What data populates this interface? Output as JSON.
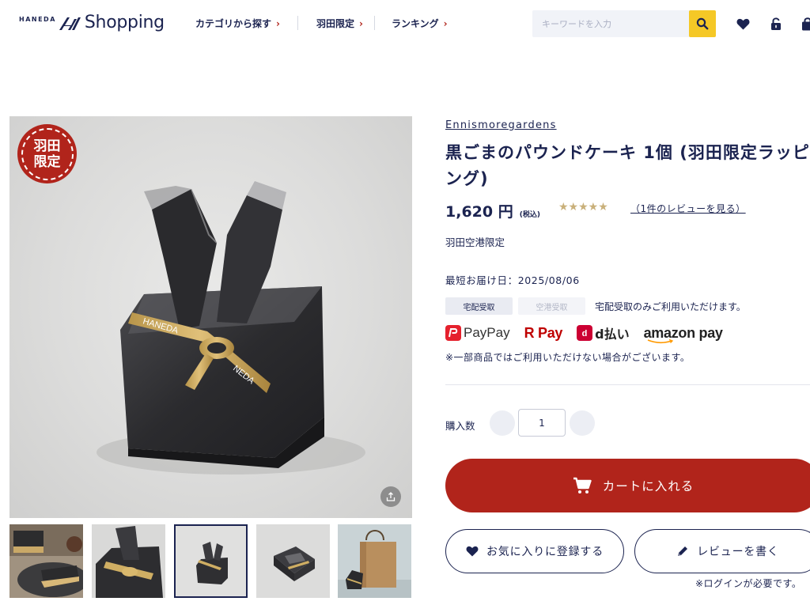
{
  "header": {
    "logo_small": "HANEDA",
    "logo_main": "Shopping",
    "nav": [
      {
        "label": "カテゴリから探す"
      },
      {
        "label": "羽田限定"
      },
      {
        "label": "ランキング"
      }
    ],
    "search_placeholder": "キーワードを入力"
  },
  "gallery": {
    "badge": "羽田限定",
    "thumbnails": [
      {
        "icon": "cake-slice-photo"
      },
      {
        "icon": "wrapped-package-photo"
      },
      {
        "icon": "wrapped-package-photo",
        "selected": true
      },
      {
        "icon": "open-package-photo"
      },
      {
        "icon": "shopping-bag-photo"
      }
    ]
  },
  "product": {
    "brand": "Ennismoregardens",
    "title": "黒ごまのパウンドケーキ 1個 (羽田限定ラッピング)",
    "price": "1,620 円",
    "tax": "(税込)",
    "rating_stars": "★★★★★",
    "rating_value": 5,
    "review_link": "（1件のレビューを見る）",
    "limited_label": "羽田空港限定",
    "delivery": "最短お届け日：2025/08/06",
    "tags": [
      "宅配受取",
      "空港受取"
    ],
    "tag_note": "宅配受取のみご利用いただけます。",
    "payment_methods": [
      {
        "label": "PayPay",
        "icon": "paypay-logo"
      },
      {
        "label": "R Pay",
        "icon": "rakuten-pay-logo"
      },
      {
        "label": "d払い",
        "icon": "d-barai-logo"
      },
      {
        "label": "amazon pay",
        "icon": "amazon-pay-logo"
      }
    ],
    "payment_note": "※一部商品ではご利用いただけない場合がございます。",
    "quantity_label": "購入数",
    "quantity": "1",
    "cart_button": "カートに入れる",
    "favorite_button": "お気に入りに登録する",
    "review_button": "レビューを書く",
    "login_note": "※ログインが必要です。"
  },
  "colors": {
    "navy": "#1b2350",
    "accent_red": "#b1241b",
    "search_yellow": "#f5c826",
    "star_gold": "#c9b07a"
  }
}
